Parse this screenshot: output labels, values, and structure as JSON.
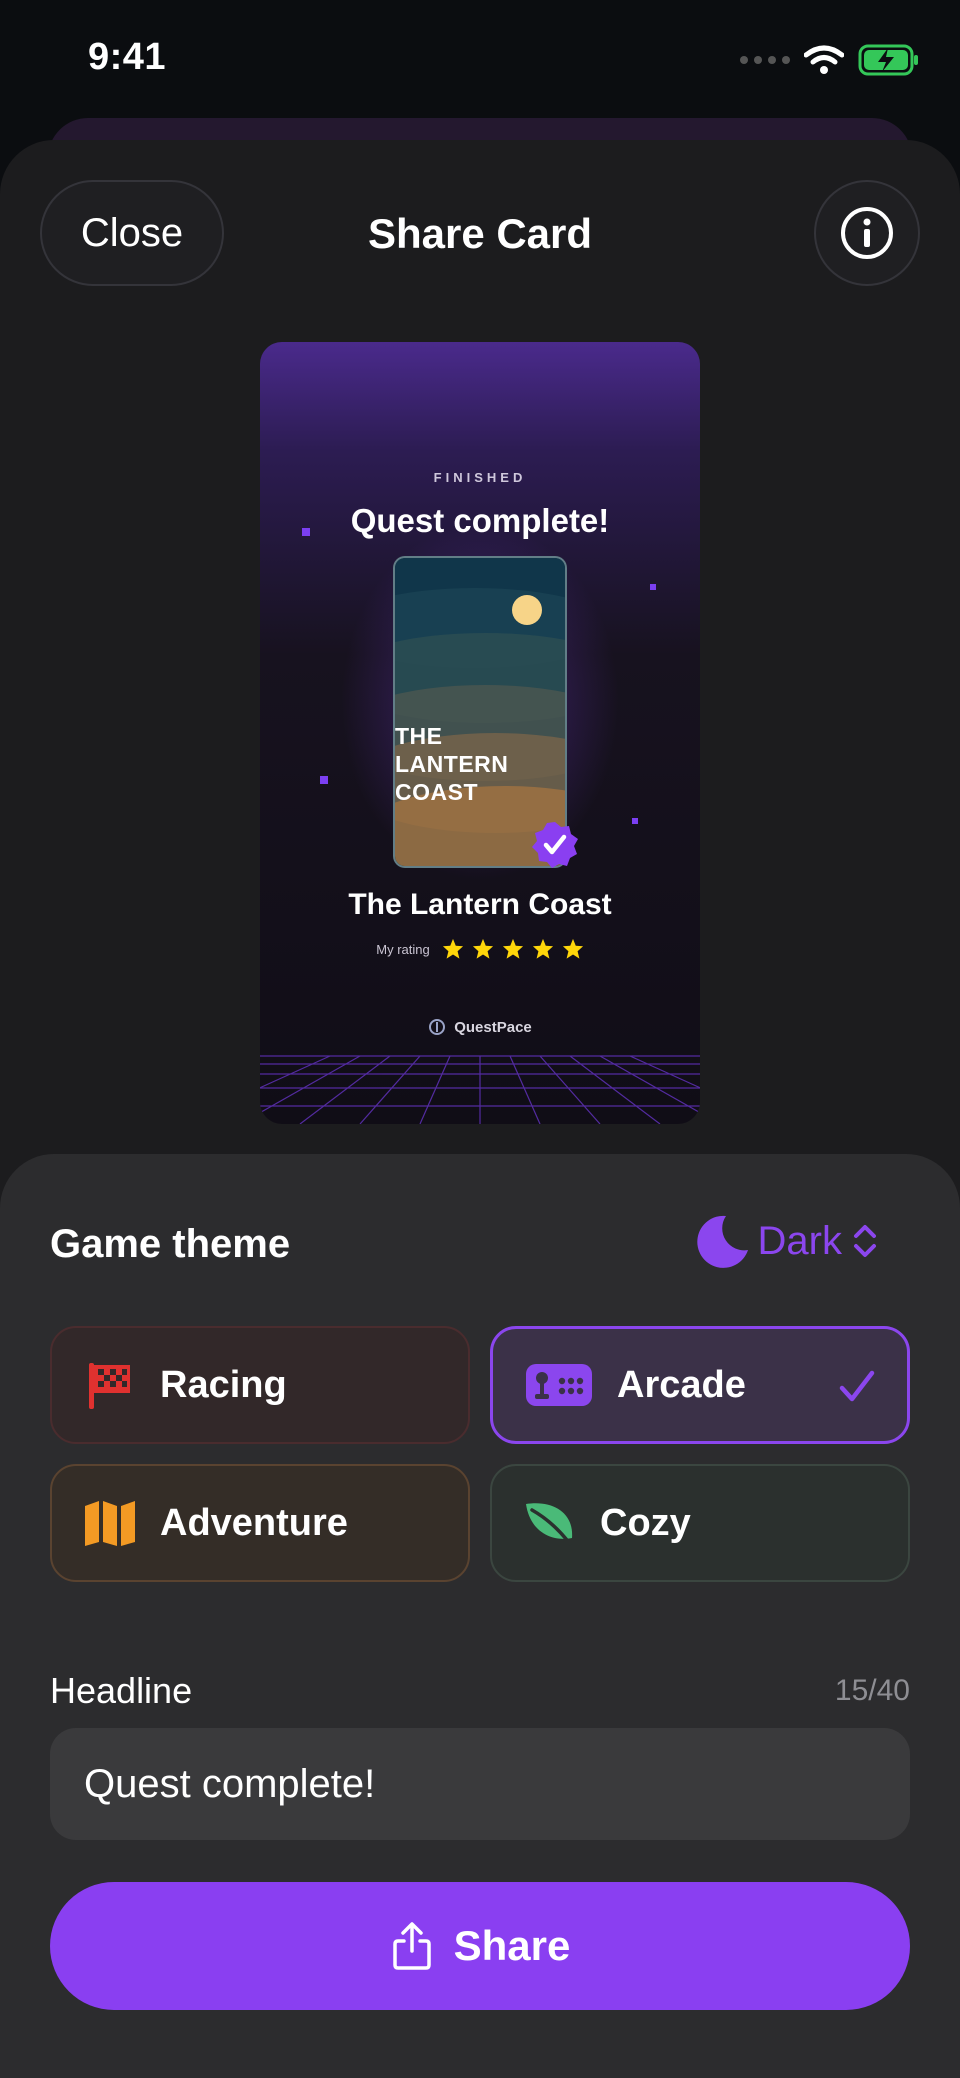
{
  "status_bar": {
    "time": "9:41"
  },
  "header": {
    "close_label": "Close",
    "title": "Share Card"
  },
  "card": {
    "eyebrow": "FINISHED",
    "headline": "Quest complete!",
    "cover_title_lines": [
      "THE",
      "LANTERN",
      "COAST"
    ],
    "game_title": "The Lantern Coast",
    "rating_label": "My rating",
    "rating": 5,
    "rating_max": 5,
    "brand": "QuestPace"
  },
  "theme_section": {
    "title": "Game theme",
    "mode_label": "Dark",
    "options": [
      {
        "label": "Racing",
        "icon": "checkered-flag-icon",
        "selected": false
      },
      {
        "label": "Arcade",
        "icon": "arcade-controller-icon",
        "selected": true
      },
      {
        "label": "Adventure",
        "icon": "map-icon",
        "selected": false
      },
      {
        "label": "Cozy",
        "icon": "leaf-icon",
        "selected": false
      }
    ]
  },
  "headline_field": {
    "label": "Headline",
    "count": "15/40",
    "value": "Quest complete!"
  },
  "share_button": {
    "label": "Share"
  },
  "colors": {
    "accent": "#8a3ff1",
    "racing": "#e0312f",
    "adventure": "#f39a24",
    "cozy": "#4aba78",
    "star": "#ffd60a"
  }
}
